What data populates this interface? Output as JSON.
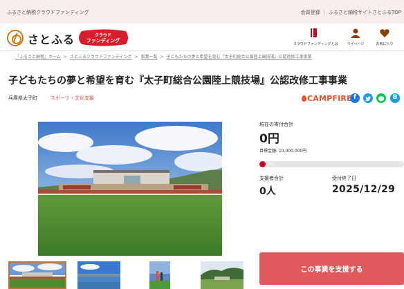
{
  "topbar": {
    "site_name": "ふるさと納税クラウドファンディング",
    "links": [
      "会員登録",
      "ふるさと納税サイトさとふるTOP"
    ]
  },
  "header": {
    "logo_text": "さとふる",
    "badge_line1": "クラウド",
    "badge_line2": "ファンディング",
    "nav": [
      {
        "label": "クラウドファンディングとは",
        "icon": "book-icon"
      },
      {
        "label": "マイページ",
        "icon": "person-icon"
      },
      {
        "label": "お気に入り",
        "icon": "heart-icon"
      }
    ]
  },
  "breadcrumb": [
    "「ふるさと納税」ホーム",
    "さとふるクラウドファンディング",
    "事業一覧",
    "子どもたちの夢と希望を育む『太子町総合公園陸上競技場』公認改修工事事業"
  ],
  "project": {
    "title": "子どもたちの夢と希望を育む『太子町総合公園陸上競技場』公認改修工事事業",
    "municipality": "兵庫県太子町",
    "category": "スポーツ・文化支援",
    "partner_logo": "CAMPFIRE"
  },
  "funding": {
    "current_label": "現在の寄付合計",
    "current_amount": "0円",
    "goal_text": "目標金額: 10,000,000円",
    "progress_percent": 0,
    "progress_text": "0%",
    "supporters_label": "支援者合計",
    "supporters_value": "0人",
    "end_label": "受付終了日",
    "end_date": "2025/12/29",
    "support_button": "この事業を支援する"
  },
  "colors": {
    "topbar_bg": "#f8eeee",
    "accent_red": "#d61f2c",
    "button_bg": "#e05a5d",
    "campfire_orange": "#e6532e",
    "logo_orange": "#c97e14"
  },
  "share_icons": [
    "facebook-icon",
    "twitter-icon",
    "line-icon",
    "hatena-icon"
  ]
}
